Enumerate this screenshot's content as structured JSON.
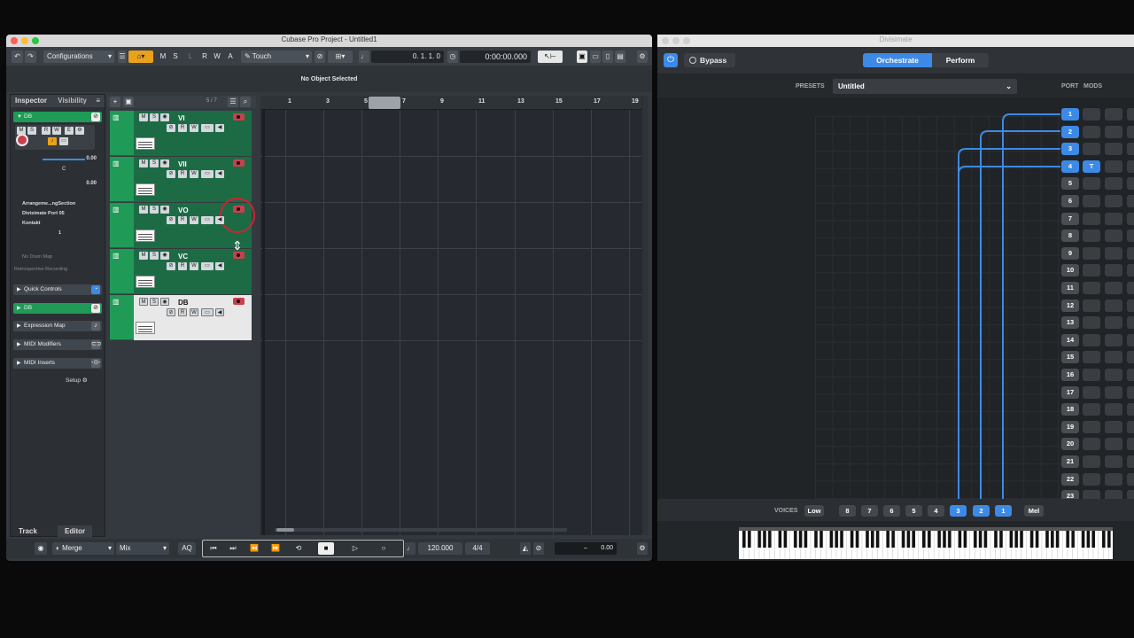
{
  "cubase": {
    "title": "Cubase Pro Project - Untitled1",
    "toolbar": {
      "configurations": "Configurations",
      "automation_mode": "Touch",
      "modes": [
        "M",
        "S",
        "L",
        "R",
        "W",
        "A"
      ],
      "position_bars": "0. 1. 1.   0",
      "position_time": "0:00:00.000"
    },
    "info_line": "No Object Selected",
    "inspector": {
      "tabs": [
        "Inspector",
        "Visibility"
      ],
      "track_name": "DB",
      "volume": "0.00",
      "pan": "C",
      "delay": "0.00",
      "routing": [
        "Arrangeme...ngSection",
        "Divisimate Port 05",
        "Kontakt"
      ],
      "channel": "1",
      "drum_map": "No Drum Map",
      "retro": "Retrospective Recording",
      "sections": [
        "Quick Controls",
        "DB",
        "Expression Map",
        "MIDI Modifiers",
        "MIDI Inserts"
      ],
      "setup": "Setup",
      "bottom_tabs": [
        "Track",
        "Editor"
      ]
    },
    "tracklist_count": "5 / 7",
    "tracks": [
      {
        "name": "VI",
        "selected": false
      },
      {
        "name": "VII",
        "selected": false
      },
      {
        "name": "VO",
        "selected": false
      },
      {
        "name": "VC",
        "selected": false
      },
      {
        "name": "DB",
        "selected": true
      }
    ],
    "ruler": [
      "1",
      "3",
      "5",
      "7",
      "9",
      "11",
      "13",
      "15",
      "17",
      "19"
    ],
    "transport": {
      "merge": "Merge",
      "mix": "Mix",
      "aq": "AQ",
      "tempo": "120.000",
      "signature": "4/4",
      "click_value": "0.00",
      "dash": "–"
    }
  },
  "divisimate": {
    "title": "Divisimate",
    "bypass": "Bypass",
    "modes": [
      "Orchestrate",
      "Perform"
    ],
    "active_mode": "Orchestrate",
    "presets_label": "PRESETS",
    "preset": "Untitled",
    "port_label": "PORT",
    "mods_label": "MODS",
    "ports": [
      "1",
      "2",
      "3",
      "4",
      "5",
      "6",
      "7",
      "8",
      "9",
      "10",
      "11",
      "12",
      "13",
      "14",
      "15",
      "16",
      "17",
      "18",
      "19",
      "20",
      "21",
      "22",
      "23"
    ],
    "active_ports": [
      "1",
      "2",
      "3",
      "4"
    ],
    "mod_t": "T",
    "voices_label": "VOICES",
    "low": "Low",
    "voices": [
      "8",
      "7",
      "6",
      "5",
      "4",
      "3",
      "2",
      "1"
    ],
    "active_voices": [
      "3",
      "2",
      "1"
    ],
    "mel": "Mel",
    "colors": {
      "accent": "#3d8ae6",
      "track_green": "#1f9a57",
      "record_red": "#c8404e"
    }
  }
}
